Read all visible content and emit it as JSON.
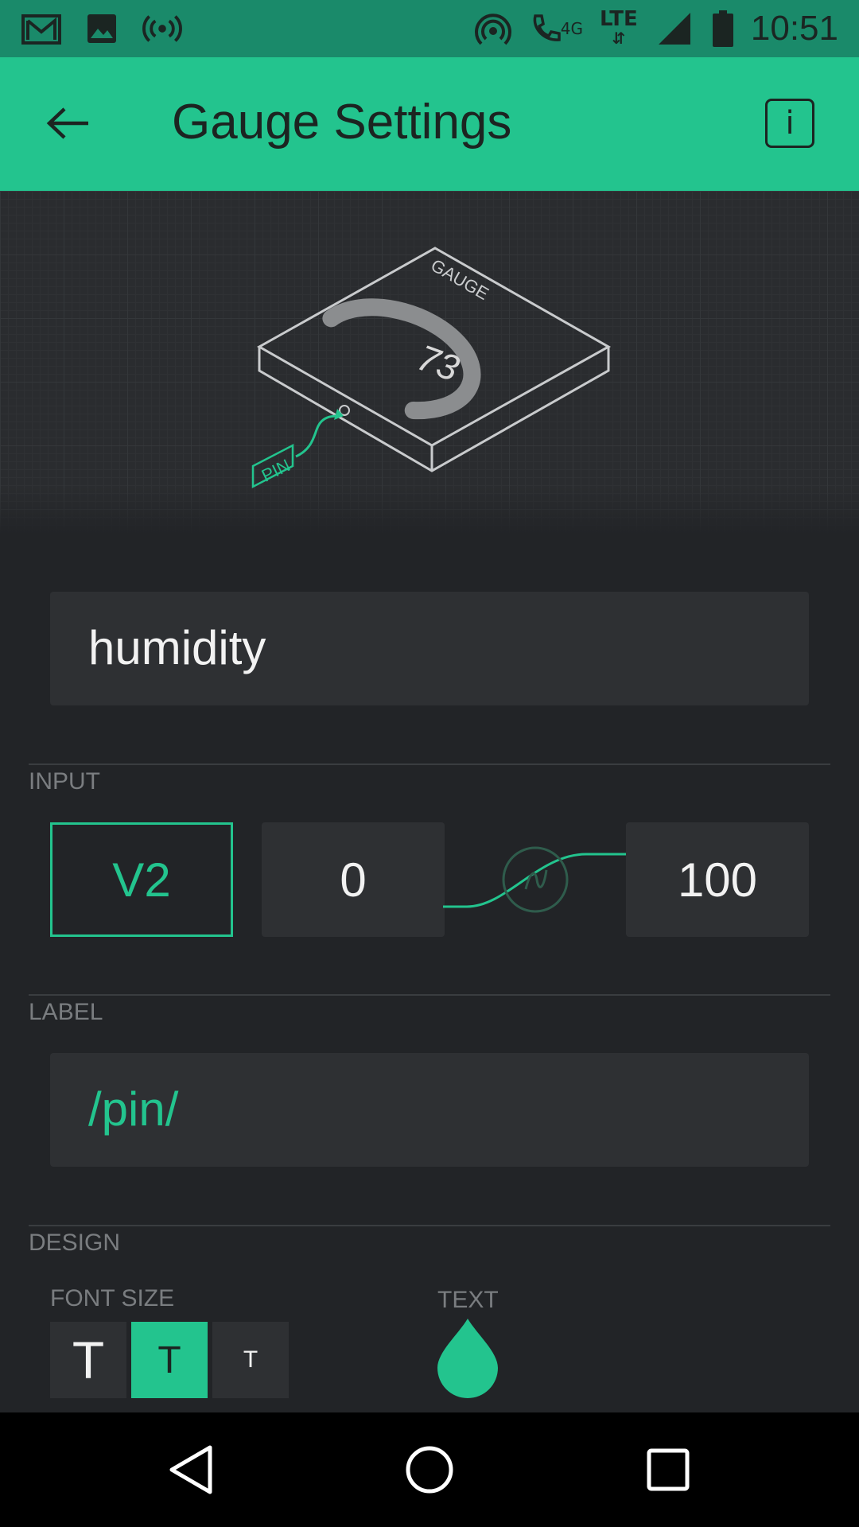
{
  "status_bar": {
    "time": "10:51",
    "left_icons": [
      "gmail-icon",
      "image-icon",
      "broadcast-icon"
    ],
    "right_icons": [
      "hotspot-icon",
      "call-4g-icon",
      "lte-icon",
      "signal-icon",
      "battery-icon"
    ],
    "network_4g": "4G",
    "network_lte": "LTE"
  },
  "app_bar": {
    "title": "Gauge Settings",
    "info_label": "i",
    "color": "#23c48e"
  },
  "hero": {
    "gauge_caption": "GAUGE",
    "gauge_value": "73",
    "pin_caption": "PIN"
  },
  "name_field": {
    "value": "humidity"
  },
  "input_section": {
    "label": "INPUT",
    "pin": "V2",
    "min": "0",
    "max": "100"
  },
  "label_section": {
    "label": "LABEL",
    "value": "/pin/"
  },
  "design_section": {
    "label": "DESIGN",
    "font_size_label": "FONT SIZE",
    "font_sizes": [
      "T",
      "T",
      "T"
    ],
    "selected_font_size_index": 1,
    "text_color_label": "TEXT",
    "text_color": "#23c48e"
  },
  "nav_bar": {
    "icons": [
      "back-triangle-icon",
      "home-circle-icon",
      "recents-square-icon"
    ]
  }
}
